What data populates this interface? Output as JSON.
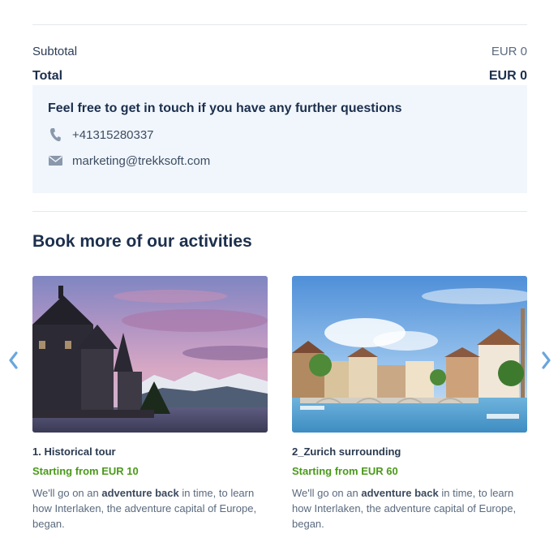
{
  "summary": {
    "subtotal_label": "Subtotal",
    "subtotal_value": "EUR 0",
    "total_label": "Total",
    "total_value": "EUR 0"
  },
  "contact": {
    "heading": "Feel free to get in touch if you have any further questions",
    "phone": "+41315280337",
    "email": "marketing@trekksoft.com",
    "icons": [
      "phone-icon",
      "envelope-icon"
    ]
  },
  "activities": {
    "title": "Book more of our activities",
    "cards": [
      {
        "name": "1. Historical tour",
        "price": "Starting from EUR 10",
        "desc_pre": "We'll go on an ",
        "desc_bold": "adventure back",
        "desc_post": " in time, to learn how Interlaken, the adventure capital of Europe, began."
      },
      {
        "name": "2_Zurich surrounding",
        "price": "Starting from EUR 60",
        "desc_pre": "We'll go on an ",
        "desc_bold": "adventure back",
        "desc_post": " in time, to learn how Interlaken, the adventure capital of Europe, began."
      }
    ]
  },
  "carousel": {
    "prev_icon": "chevron-left-icon",
    "next_icon": "chevron-right-icon"
  },
  "colors": {
    "heading": "#1c2f4d",
    "price_green": "#4a9a1a",
    "contact_bg": "#f1f6fd",
    "arrow_blue": "#6aa6dd"
  }
}
